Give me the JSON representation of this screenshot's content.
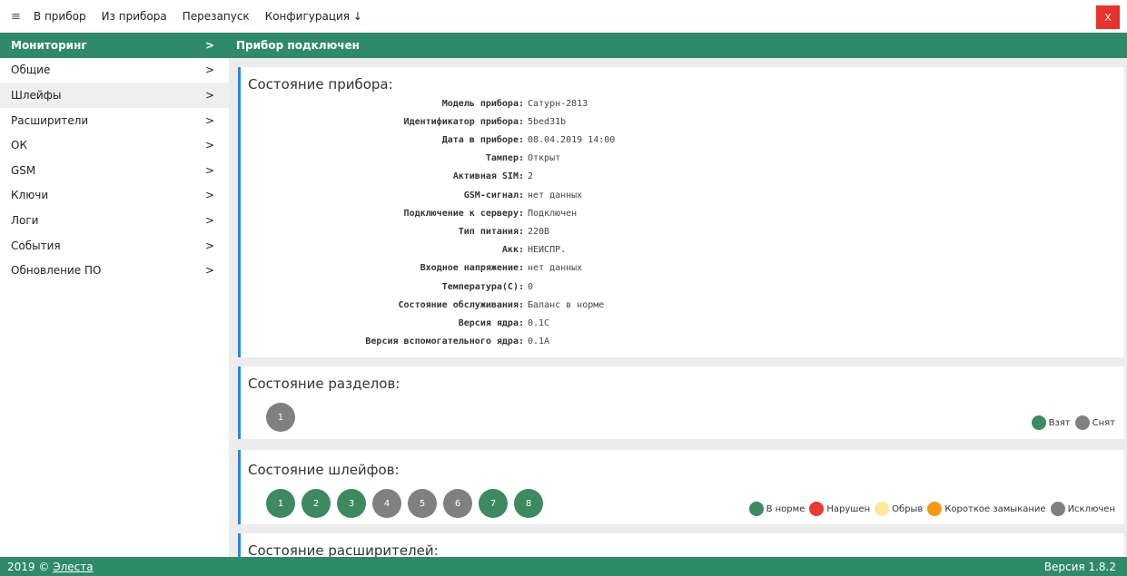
{
  "topbar": {
    "hamburger": "≡",
    "menu": [
      "В прибор",
      "Из прибора",
      "Перезапуск",
      "Конфигурация ↓"
    ],
    "close": "X"
  },
  "sidebar": {
    "items": [
      {
        "label": "Мониторинг",
        "chevron": ">"
      },
      {
        "label": "Общие",
        "chevron": ">"
      },
      {
        "label": "Шлейфы",
        "chevron": ">"
      },
      {
        "label": "Расширители",
        "chevron": ">"
      },
      {
        "label": "ОК",
        "chevron": ">"
      },
      {
        "label": "GSM",
        "chevron": ">"
      },
      {
        "label": "Ключи",
        "chevron": ">"
      },
      {
        "label": "Логи",
        "chevron": ">"
      },
      {
        "label": "События",
        "chevron": ">"
      },
      {
        "label": "Обновление ПО",
        "chevron": ">"
      }
    ]
  },
  "main": {
    "header": "Прибор подключен",
    "device": {
      "title": "Состояние прибора:",
      "rows": [
        {
          "k": "Модель прибора:",
          "v": "Сатурн-2813"
        },
        {
          "k": "Идентификатор прибора:",
          "v": "5bed31b"
        },
        {
          "k": "Дата в приборе:",
          "v": "08.04.2019 14:00"
        },
        {
          "k": "Тампер:",
          "v": "Открыт"
        },
        {
          "k": "Активная SIM:",
          "v": "2"
        },
        {
          "k": "GSM-сигнал:",
          "v": "нет данных"
        },
        {
          "k": "Подключение к серверу:",
          "v": "Подключен"
        },
        {
          "k": "Тип питания:",
          "v": "220В"
        },
        {
          "k": "Акк:",
          "v": "НЕИСПР."
        },
        {
          "k": "Входное напряжение:",
          "v": "нет данных"
        },
        {
          "k": "Температура(С):",
          "v": "0"
        },
        {
          "k": "Состояние обслуживания:",
          "v": "Баланс в норме"
        },
        {
          "k": "Версия ядра:",
          "v": "0.1C"
        },
        {
          "k": "Версия вспомогательного ядра:",
          "v": "0.1A"
        }
      ]
    },
    "sections": {
      "title": "Состояние разделов:",
      "items": [
        {
          "label": "1",
          "color": "#808080"
        }
      ],
      "legend": [
        {
          "label": "Взят",
          "color": "#3d8a60"
        },
        {
          "label": "Снят",
          "color": "#808080"
        }
      ]
    },
    "loops": {
      "title": "Состояние шлейфов:",
      "items": [
        {
          "label": "1",
          "color": "#3d8a60"
        },
        {
          "label": "2",
          "color": "#3d8a60"
        },
        {
          "label": "3",
          "color": "#3d8a60"
        },
        {
          "label": "4",
          "color": "#808080"
        },
        {
          "label": "5",
          "color": "#808080"
        },
        {
          "label": "6",
          "color": "#808080"
        },
        {
          "label": "7",
          "color": "#3d8a60"
        },
        {
          "label": "8",
          "color": "#3d8a60"
        }
      ],
      "legend": [
        {
          "label": "В норме",
          "color": "#3d8a60"
        },
        {
          "label": "Нарушен",
          "color": "#e83a33"
        },
        {
          "label": "Обрыв",
          "color": "#fde79a"
        },
        {
          "label": "Короткое замыкание",
          "color": "#f59a12"
        },
        {
          "label": "Исключен",
          "color": "#808080"
        }
      ]
    },
    "expanders": {
      "title": "Состояние расширителей:"
    }
  },
  "footer": {
    "copyright": "2019 ©",
    "link": "Элеста",
    "version": "Версия 1.8.2"
  },
  "colors": {
    "accent": "#2f8a6a",
    "card_border": "#2e86d8",
    "close": "#e8322c"
  }
}
